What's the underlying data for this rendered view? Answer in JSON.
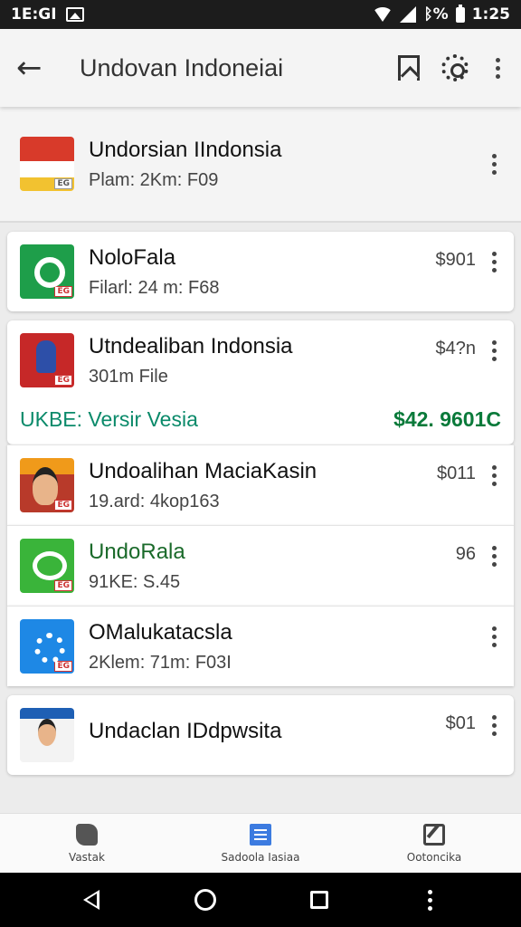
{
  "status_bar": {
    "left_text": "1E:GI",
    "right_text": "ᛒ%",
    "time": "1:25"
  },
  "app_bar": {
    "title": "Undovan Indoneiai"
  },
  "header_item": {
    "name": "Undorsian IIndonsia",
    "sub": "Plam: 2Km: F09"
  },
  "items": [
    {
      "name": "NoloFala",
      "sub": "Filarl: 24 m: F68",
      "price": "$901",
      "icon": "green-app-icon",
      "thumb": "th-green",
      "tag": "EG"
    },
    {
      "name": "Utndealiban Indonsia",
      "sub": "301m File",
      "price": "$4?n",
      "icon": "figure-app-icon",
      "thumb": "th-red",
      "tag": "EG",
      "extra_left": "UKBE: Versir Vesia",
      "extra_right": "$42. 9601C"
    },
    {
      "name": "Undoalihan MaciaKasin",
      "sub": "19.ard: 4kop163",
      "price": "$011",
      "icon": "portrait-app-icon",
      "thumb": "th-orange",
      "tag": "EG"
    },
    {
      "name": "UndoRala",
      "sub": "91KE: S.45",
      "price": "96",
      "icon": "chat-app-icon",
      "thumb": "th-lime",
      "tag": "EG"
    },
    {
      "name": "OMalukatacsla",
      "sub": "2Klem: 71m: F03I",
      "price": "",
      "icon": "settings-app-icon",
      "thumb": "th-blue",
      "tag": "EG"
    },
    {
      "name": "Undaclan IDdpwsita",
      "sub": "",
      "price": "$01",
      "icon": "person-app-icon",
      "thumb": "th-person",
      "tag": ""
    }
  ],
  "bottom_tabs": [
    {
      "label": "Vastak",
      "icon": "puzzle-icon"
    },
    {
      "label": "Sadoola Iasiaa",
      "icon": "document-icon"
    },
    {
      "label": "Ootoncika",
      "icon": "edit-icon"
    }
  ],
  "colors": {
    "green_text": "#0a8a6a",
    "green_price": "#0a7a3a",
    "status_bg": "#1c1c1c"
  }
}
